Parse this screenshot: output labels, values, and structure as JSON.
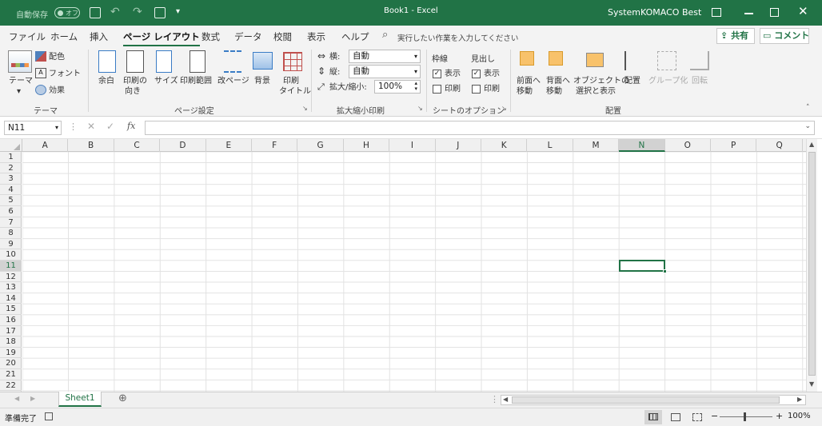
{
  "titlebar": {
    "autosave_label": "自動保存",
    "autosave_state": "オフ",
    "title": "Book1  -  Excel",
    "user": "SystemKOMACO Best"
  },
  "tabs": [
    "ファイル",
    "ホーム",
    "挿入",
    "ページ レイアウト",
    "数式",
    "データ",
    "校閲",
    "表示",
    "ヘルプ"
  ],
  "active_tab": 3,
  "tellme": "実行したい作業を入力してください",
  "share": "共有",
  "comment": "コメント",
  "ribbon": {
    "theme": {
      "label": "テーマ",
      "colors": "配色",
      "fonts": "フォント",
      "effects": "効果",
      "group": "テーマ"
    },
    "page": {
      "margins": "余白",
      "orient1": "印刷の",
      "orient2": "向き",
      "size": "サイズ",
      "area": "印刷範囲",
      "breaks": "改ページ",
      "bg": "背景",
      "titles1": "印刷",
      "titles2": "タイトル",
      "group": "ページ設定"
    },
    "scale": {
      "width_label": "横:",
      "width_val": "自動",
      "height_label": "縦:",
      "height_val": "自動",
      "scale_label": "拡大/縮小:",
      "scale_val": "100%",
      "group": "拡大縮小印刷"
    },
    "sheet": {
      "grid": "枠線",
      "head": "見出し",
      "view": "表示",
      "print": "印刷",
      "group": "シートのオプション"
    },
    "arrange": {
      "fwd1": "前面へ",
      "fwd2": "移動",
      "back1": "背面へ",
      "back2": "移動",
      "sel1": "オブジェクトの",
      "sel2": "選択と表示",
      "align": "配置",
      "grp": "グループ化",
      "rot": "回転",
      "group": "配置"
    }
  },
  "namebox": "N11",
  "fx": "fx",
  "columns": [
    "A",
    "B",
    "C",
    "D",
    "E",
    "F",
    "G",
    "H",
    "I",
    "J",
    "K",
    "L",
    "M",
    "N",
    "O",
    "P",
    "Q"
  ],
  "selected_col": "N",
  "rows": [
    "1",
    "2",
    "3",
    "4",
    "5",
    "6",
    "7",
    "8",
    "9",
    "10",
    "11",
    "12",
    "13",
    "14",
    "15",
    "16",
    "17",
    "18",
    "19",
    "20",
    "21",
    "22"
  ],
  "selected_row": "11",
  "sheet_tab": "Sheet1",
  "status": {
    "ready": "準備完了",
    "zoom": "100%"
  },
  "colors": {
    "accent": "#217346"
  }
}
